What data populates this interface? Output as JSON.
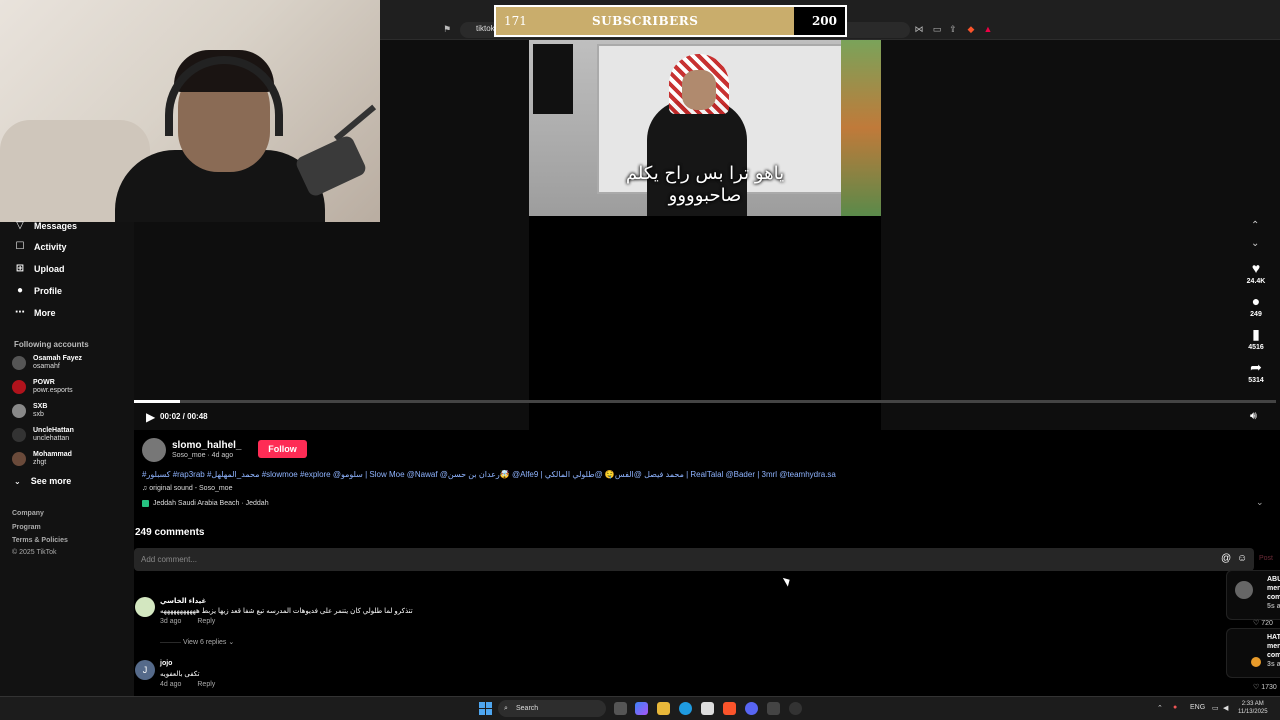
{
  "browser": {
    "address": "tiktok"
  },
  "subscriber_bar": {
    "current": "171",
    "label": "SUBSCRIBERS",
    "goal": "200",
    "progress_fraction": 0.855,
    "fill_color": "#c9ad6c"
  },
  "sidebar": {
    "nav": [
      {
        "label": "Messages",
        "icon": "messages-icon"
      },
      {
        "label": "Activity",
        "icon": "activity-icon"
      },
      {
        "label": "Upload",
        "icon": "upload-icon"
      },
      {
        "label": "Profile",
        "icon": "profile-icon"
      },
      {
        "label": "More",
        "icon": "more-icon"
      }
    ],
    "following_title": "Following accounts",
    "accounts": [
      {
        "name": "Osamah Fayez",
        "handle": "osamahf"
      },
      {
        "name": "POWR",
        "handle": "powr.esports"
      },
      {
        "name": "SXB",
        "handle": "sxb"
      },
      {
        "name": "UncleHattan",
        "handle": "unclehattan"
      },
      {
        "name": "Mohammad",
        "handle": "zhgt"
      }
    ],
    "see_more": "See more",
    "footer": [
      "Company",
      "Program",
      "Terms & Policies",
      "© 2025 TikTok"
    ]
  },
  "video": {
    "caption_line1": "ياهو ترا بس راح يكلم",
    "caption_line2": "صاحبوووو",
    "time": "00:02 / 00:48",
    "progress_fraction": 0.04
  },
  "actions": {
    "likes": "24.4K",
    "comments": "249",
    "saves": "4516",
    "shares": "5314"
  },
  "post": {
    "username": "slomo_halhel_",
    "sub": "Soso_moe · 4d ago",
    "follow": "Follow",
    "description": "#كسبلور #rap3rab #محمد_المهلهل #slowmoe #explore @سلومو | Slow Moe @Nawaf @رعدان بن حسن🤯 @Alfe9 | محمد فيصل @الفس🤤 @طلولي المالكي | RealTalal @Bader | 3mrl @teamhydra.sa",
    "sound": "♫ original sound - Soso_moe",
    "location": "Jeddah Saudi Arabia Beach · Jeddah"
  },
  "comments": {
    "count_label": "249 comments",
    "placeholder": "Add comment...",
    "post_label": "Post",
    "items": [
      {
        "author": "غيداء الخاسي",
        "text": "تتذكرو لما طلولي كان يتنمر على فديوهات المدرسه تبع شفا قعد زيها يزبط هههههههههههه",
        "date": "3d ago",
        "reply": "Reply",
        "view_replies": "View 6 replies"
      },
      {
        "author": "jojo",
        "text": "تكفى بالعفويه",
        "date": "4d ago",
        "reply": "Reply"
      }
    ]
  },
  "right_cards": [
    {
      "name": "ABU",
      "lines": [
        "men",
        "com",
        "5s a"
      ],
      "likes": "720"
    },
    {
      "name": "HAT",
      "lines": [
        "men",
        "com",
        "3s a"
      ],
      "likes": "1730"
    }
  ],
  "taskbar": {
    "search": "Search",
    "lang": "ENG",
    "time": "2:33 AM",
    "date": "11/13/2025"
  }
}
